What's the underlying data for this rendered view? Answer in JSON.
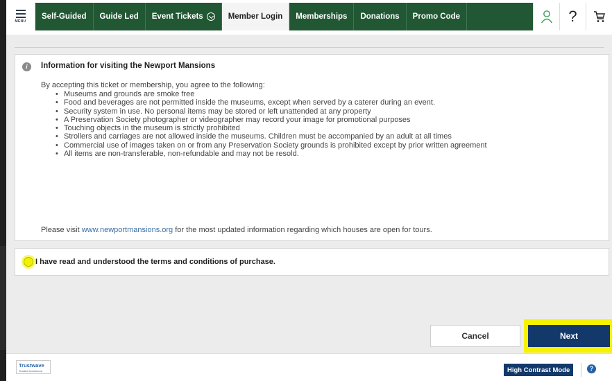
{
  "nav": {
    "menu_label": "MENU",
    "tabs": [
      {
        "label": "Self-Guided"
      },
      {
        "label": "Guide Led"
      },
      {
        "label": "Event Tickets"
      },
      {
        "label": "Member Login"
      },
      {
        "label": "Memberships"
      },
      {
        "label": "Donations"
      },
      {
        "label": "Promo Code"
      }
    ],
    "active_tab": "Member Login",
    "help_glyph": "?",
    "icons": [
      "menu-icon",
      "chevron-down-icon",
      "user-icon",
      "help-icon",
      "cart-icon"
    ],
    "colors": {
      "nav_green": "#215732",
      "active_tab_bg": "#f4f4f4"
    }
  },
  "info": {
    "icon": "info-icon",
    "icon_glyph": "i",
    "title": "Information for visiting the Newport Mansions",
    "intro": "By accepting this ticket or membership, you agree to the following:",
    "rules": [
      "Museums and grounds are smoke free",
      "Food and beverages are not permitted inside the museums, except when served by a caterer during an event.",
      "Security system in use. No personal items may be stored or left unattended at any property",
      "A Preservation Society photographer or videographer may record your image for promotional purposes",
      "Touching objects in the museum is strictly prohibited",
      "Strollers and carriages are not allowed inside the museums. Children must be accompanied by an adult at all times",
      "Commercial use of images taken on or from any Preservation Society grounds is prohibited except by prior written agreement",
      "All items are non-transferable, non-refundable and may not be resold."
    ],
    "visit_prefix": "Please visit",
    "visit_link": "www.newportmansions.org",
    "visit_suffix": "for the most updated information regarding which houses are open for tours."
  },
  "terms": {
    "label": "I have read and understood the terms and conditions of purchase.",
    "checked": false
  },
  "actions": {
    "cancel_label": "Cancel",
    "next_label": "Next",
    "colors": {
      "primary": "#13396b",
      "highlight": "#f7f300"
    }
  },
  "footer": {
    "trust_name": "Trustwave",
    "trust_sub": "Trusted Commerce",
    "high_contrast_label": "High Contrast Mode",
    "help_glyph": "?"
  }
}
